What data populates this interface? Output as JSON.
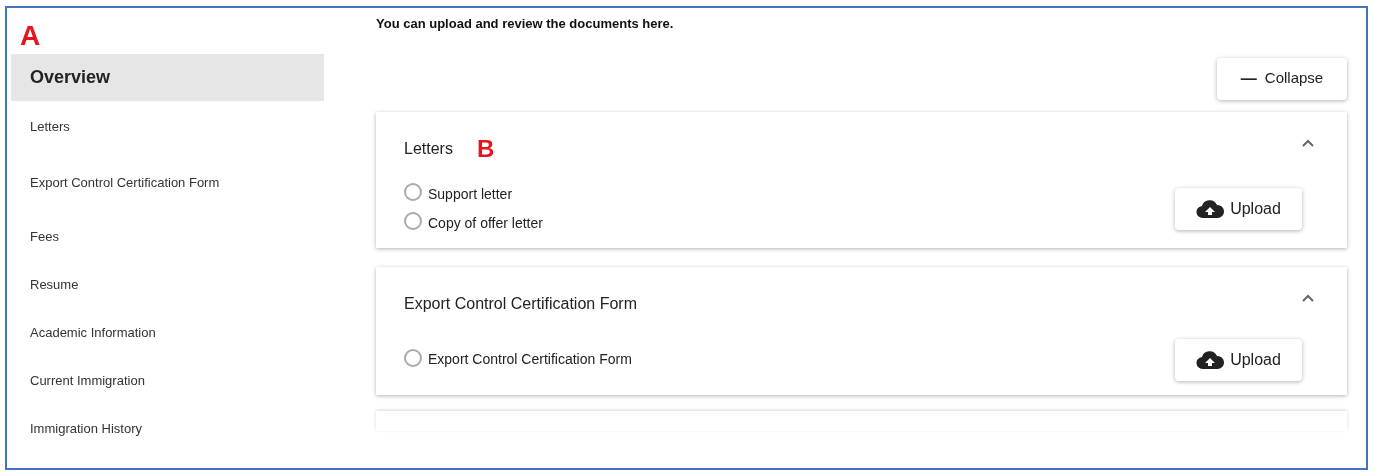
{
  "annotations": {
    "sidebar": "A",
    "first_section": "B"
  },
  "sidebar": {
    "items": [
      {
        "label": "Overview",
        "selected": true
      },
      {
        "label": "Letters",
        "selected": false
      },
      {
        "label": "Export Control Certification Form",
        "selected": false
      },
      {
        "label": "Fees",
        "selected": false
      },
      {
        "label": "Resume",
        "selected": false
      },
      {
        "label": "Academic Information",
        "selected": false
      },
      {
        "label": "Current Immigration",
        "selected": false
      },
      {
        "label": "Immigration History",
        "selected": false
      }
    ]
  },
  "intro": "You can upload and review the documents here.",
  "collapse_button": {
    "label": "Collapse",
    "icon": "—"
  },
  "sections": [
    {
      "title": "Letters",
      "expanded": true,
      "documents": [
        {
          "label": "Support letter",
          "selected": false
        },
        {
          "label": "Copy of offer letter",
          "selected": false
        }
      ],
      "upload_button": "Upload"
    },
    {
      "title": "Export Control Certification Form",
      "expanded": true,
      "documents": [
        {
          "label": "Export Control Certification Form",
          "selected": false
        }
      ],
      "upload_button": "Upload"
    }
  ]
}
